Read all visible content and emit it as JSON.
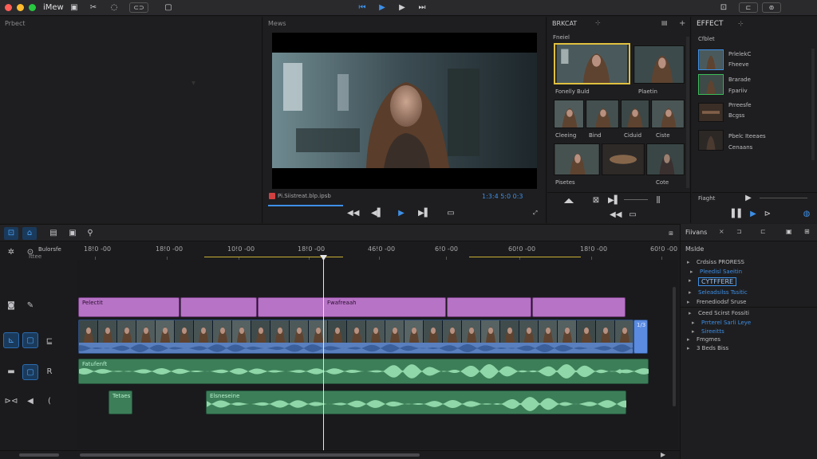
{
  "window": {
    "title": "iMew"
  },
  "colors": {
    "accent": "#3d8fe6",
    "purple_clip": "#b773c5",
    "green_clip": "#3c7e58",
    "blue_clip": "#5a7fbf",
    "playhead": "#e6e6e6",
    "selection": "#e8c442"
  },
  "toolbar": {
    "icons": [
      "import-icon",
      "tools-icon",
      "effects-icon",
      "chain-icon"
    ],
    "transport": [
      "rewind-icon",
      "play-icon",
      "play-icon",
      "next-icon"
    ]
  },
  "project": {
    "title": "Prbect"
  },
  "viewer": {
    "title": "Mews",
    "clip_name": "Pi.Siistreat.blp.ipsb",
    "timecode": "1:3:4 5:0 0:3"
  },
  "media": {
    "title": "BRKCAT",
    "group": "Fneiel",
    "items": [
      {
        "label": "Fonelly  Buld"
      },
      {
        "label": "Plaetin"
      },
      {
        "label": "Cleeing"
      },
      {
        "label": "Bind"
      },
      {
        "label": "Ciduid"
      },
      {
        "label": "Ciste"
      },
      {
        "label": "Pisetes"
      },
      {
        "label": "Cote"
      }
    ]
  },
  "effects": {
    "title": "EFFECT",
    "group": "Cfblet",
    "items": [
      {
        "label": "PrlelekC"
      },
      {
        "label": "Fheeve"
      },
      {
        "label": "Brarade"
      },
      {
        "label": "Fpariiv"
      },
      {
        "label": "Prreesfe"
      },
      {
        "label": "Bcgss"
      },
      {
        "label": "Pbelc Iteeaes"
      },
      {
        "label": "Cenaans"
      }
    ],
    "footer": "Fiaght"
  },
  "timeline": {
    "ruler": [
      "18!0 -00",
      "18!0 -00",
      "10!0 -00",
      "18!0 -00",
      "46!0 -00",
      "6!0 -00",
      "60!0 -00",
      "18!0 -00",
      "60!0 -00"
    ],
    "track_labels": {
      "first_name": "Bulorsfe",
      "first_sub": "Ittee"
    },
    "purple_clips": [
      {
        "label": "Pelectit"
      },
      {
        "label": "Fwafreaah"
      }
    ],
    "blue_end_label": "1/3",
    "audio_main_label": "Fatufenft",
    "audio_clips": [
      {
        "label": "Tetaes"
      },
      {
        "label": "Elsneseine"
      }
    ]
  },
  "inspector": {
    "tab": "Fiivans",
    "title": "Mslde",
    "rows": [
      {
        "text": "Crdsiss PRORESS",
        "cls": ""
      },
      {
        "text": "Pleedisl Saeitin",
        "cls": "blue"
      },
      {
        "text": "CYTFFERE",
        "cls": "box"
      },
      {
        "text": "Seleadsilss Tssitic",
        "cls": "blue"
      },
      {
        "text": "Frenediodsf Sruse",
        "cls": ""
      },
      {
        "text": "Ceed Scirst Fossiti",
        "cls": ""
      },
      {
        "text": "Prrterel Sarli Leye",
        "cls": "blue"
      },
      {
        "text": "Sireeitts",
        "cls": "blue"
      },
      {
        "text": "Fmgmes",
        "cls": ""
      },
      {
        "text": "3 Beds Biss",
        "cls": ""
      }
    ]
  }
}
